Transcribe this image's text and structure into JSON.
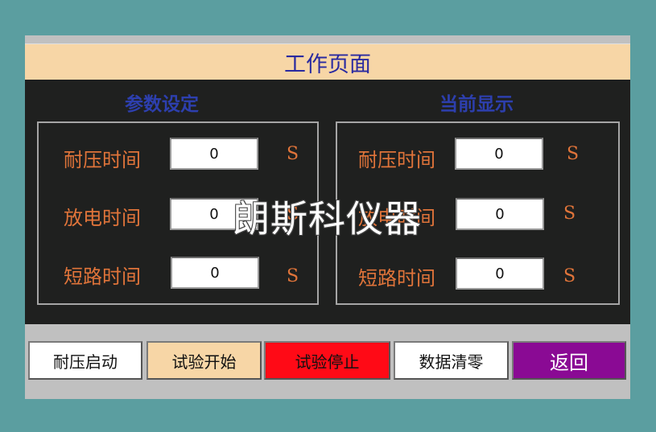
{
  "title": "工作页面",
  "left": {
    "heading": "参数设定",
    "rows": [
      {
        "label": "耐压时间",
        "value": "0",
        "unit": "S"
      },
      {
        "label": "放电时间",
        "value": "0",
        "unit": "S"
      },
      {
        "label": "短路时间",
        "value": "0",
        "unit": "S"
      }
    ]
  },
  "right": {
    "heading": "当前显示",
    "rows": [
      {
        "label": "耐压时间",
        "value": "0",
        "unit": "S"
      },
      {
        "label": "放电时间",
        "value": "0",
        "unit": "S"
      },
      {
        "label": "短路时间",
        "value": "0",
        "unit": "S"
      }
    ]
  },
  "buttons": {
    "withstand_start": "耐压启动",
    "test_start": "试验开始",
    "test_stop": "试验停止",
    "data_clear": "数据清零",
    "back": "返回"
  },
  "watermark": "朗斯科仪器",
  "colors": {
    "title_bg": "#f7d6a6",
    "heading": "#2d3fae",
    "label": "#e0743a",
    "stop_bg": "#ff0a16",
    "back_bg": "#8a0a94"
  }
}
